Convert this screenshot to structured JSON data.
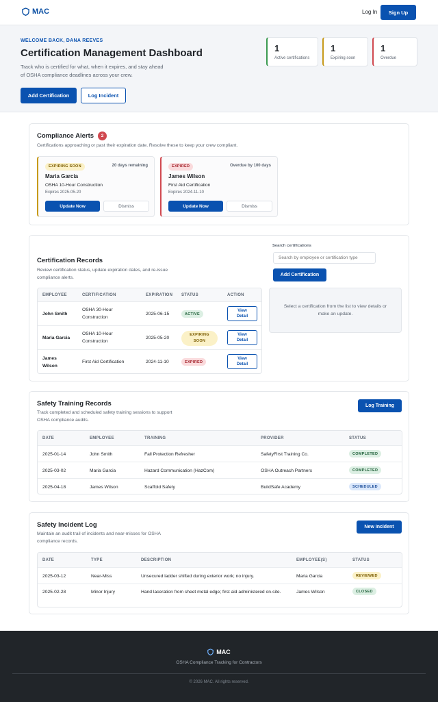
{
  "header": {
    "brand": "MAC",
    "login": "Log In",
    "signup": "Sign Up"
  },
  "hero": {
    "welcome": "WELCOME BACK, DANA REEVES",
    "title": "Certification Management Dashboard",
    "subtitle": "Track who is certified for what, when it expires, and stay ahead of OSHA compliance deadlines across your crew.",
    "add_cert": "Add Certification",
    "log_incident": "Log Incident",
    "stats": [
      {
        "value": "1",
        "label": "Active certifications",
        "color": "#3a9a50"
      },
      {
        "value": "1",
        "label": "Expiring soon",
        "color": "#c79a1a"
      },
      {
        "value": "1",
        "label": "Overdue",
        "color": "#d0484f"
      }
    ]
  },
  "alerts": {
    "title": "Compliance Alerts",
    "count": "2",
    "subtitle": "Certifications approaching or past their expiration date. Resolve these to keep your crew compliant.",
    "items": [
      {
        "badge": "EXPIRING SOON",
        "status_text": "20 days remaining",
        "name": "Maria Garcia",
        "cert": "OSHA 10-Hour Construction",
        "expires": "Expires 2025-05-20",
        "update": "Update Now",
        "dismiss": "Dismiss",
        "accent": "#c79a1a"
      },
      {
        "badge": "EXPIRED",
        "status_text": "Overdue by 100 days",
        "name": "James Wilson",
        "cert": "First Aid Certification",
        "expires": "Expires 2024-11-10",
        "update": "Update Now",
        "dismiss": "Dismiss",
        "accent": "#d0484f"
      }
    ]
  },
  "records": {
    "title": "Certification Records",
    "subtitle": "Review certification status, update expiration dates, and re-issue compliance alerts.",
    "search_label": "Search certifications",
    "search_placeholder": "Search by employee or certification type",
    "add_cert": "Add Certification",
    "detail_placeholder": "Select a certification from the list to view details or make an update.",
    "columns": [
      "EMPLOYEE",
      "CERTIFICATION",
      "EXPIRATION",
      "STATUS",
      "ACTION"
    ],
    "rows": [
      {
        "employee": "John Smith",
        "cert": "OSHA 30-Hour Construction",
        "expiration": "2025-06-15",
        "status": "ACTIVE",
        "action": "View Detail"
      },
      {
        "employee": "Maria Garcia",
        "cert": "OSHA 10-Hour Construction",
        "expiration": "2025-05-20",
        "status": "EXPIRING SOON",
        "action": "View Detail"
      },
      {
        "employee": "James Wilson",
        "cert": "First Aid Certification",
        "expiration": "2024-11-10",
        "status": "EXPIRED",
        "action": "View Detail"
      }
    ]
  },
  "training": {
    "title": "Safety Training Records",
    "subtitle": "Track completed and scheduled safety training sessions to support OSHA compliance audits.",
    "button": "Log Training",
    "columns": [
      "DATE",
      "EMPLOYEE",
      "TRAINING",
      "PROVIDER",
      "STATUS"
    ],
    "rows": [
      {
        "date": "2025-01-14",
        "employee": "John Smith",
        "training": "Fall Protection Refresher",
        "provider": "SafetyFirst Training Co.",
        "status": "COMPLETED"
      },
      {
        "date": "2025-03-02",
        "employee": "Maria Garcia",
        "training": "Hazard Communication (HazCom)",
        "provider": "OSHA Outreach Partners",
        "status": "COMPLETED"
      },
      {
        "date": "2025-04-18",
        "employee": "James Wilson",
        "training": "Scaffold Safety",
        "provider": "BuildSafe Academy",
        "status": "SCHEDULED"
      }
    ]
  },
  "incidents": {
    "title": "Safety Incident Log",
    "subtitle": "Maintain an audit trail of incidents and near-misses for OSHA compliance records.",
    "button": "New Incident",
    "columns": [
      "DATE",
      "TYPE",
      "DESCRIPTION",
      "EMPLOYEE(S)",
      "STATUS"
    ],
    "rows": [
      {
        "date": "2025-03-12",
        "type": "Near-Miss",
        "description": "Unsecured ladder shifted during exterior work; no injury.",
        "employee": "Maria Garcia",
        "status": "REVIEWED"
      },
      {
        "date": "2025-02-28",
        "type": "Minor Injury",
        "description": "Hand laceration from sheet metal edge; first aid administered on-site.",
        "employee": "James Wilson",
        "status": "CLOSED"
      }
    ]
  },
  "footer": {
    "brand": "MAC",
    "tagline": "OSHA Compliance Tracking for Contractors",
    "copyright": "© 2026 MAC. All rights reserved."
  }
}
